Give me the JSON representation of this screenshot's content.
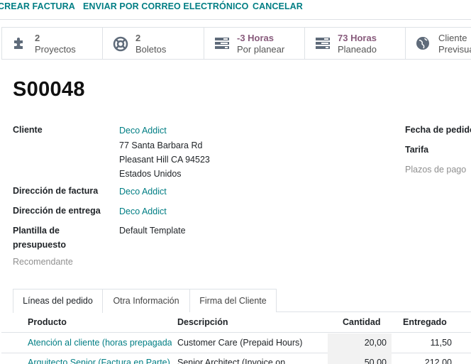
{
  "actions": {
    "create_invoice": "CREAR FACTURA",
    "send_email": "ENVIAR POR CORREO ELECTRÓNICO",
    "cancel": "CANCELAR"
  },
  "stats": [
    {
      "value": "2",
      "label": "Proyectos",
      "icon": "puzzle-icon"
    },
    {
      "value": "2",
      "label": "Boletos",
      "icon": "life-ring-icon"
    },
    {
      "value": "-3 Horas",
      "label": "Por planear",
      "icon": "tasks-icon"
    },
    {
      "value": "73 Horas",
      "label": "Planeado",
      "icon": "tasks-icon"
    },
    {
      "value": "Cliente",
      "label": "Previsualizar",
      "icon": "globe-icon"
    }
  ],
  "order": {
    "name": "S00048",
    "customer_label": "Cliente",
    "customer": "Deco Addict",
    "address_line1": "77 Santa Barbara Rd",
    "address_line2": "Pleasant Hill CA 94523",
    "address_line3": "Estados Unidos",
    "invoice_address_label": "Dirección de factura",
    "invoice_address": "Deco Addict",
    "delivery_address_label": "Dirección de entrega",
    "delivery_address": "Deco Addict",
    "template_label_1": "Plantilla de",
    "template_label_2": "presupuesto",
    "template": "Default Template",
    "referrer_label": "Recomendante",
    "order_date_label": "Fecha de pedido",
    "pricelist_label": "Tarifa",
    "payment_terms_label": "Plazos de pago"
  },
  "tabs": [
    "Líneas del pedido",
    "Otra Información",
    "Firma del Cliente"
  ],
  "table": {
    "headers": {
      "product": "Producto",
      "description": "Descripción",
      "quantity": "Cantidad",
      "delivered": "Entregado"
    },
    "rows": [
      {
        "product": "Atención al cliente (horas prepagadas)",
        "description": "Customer Care (Prepaid Hours)",
        "quantity": "20,00",
        "delivered": "11,50"
      },
      {
        "product": "Arquitecto Senior (Factura en Parte)",
        "description": "Senior Architect (Invoice on",
        "quantity": "50,00",
        "delivered": "212,00"
      }
    ]
  }
}
